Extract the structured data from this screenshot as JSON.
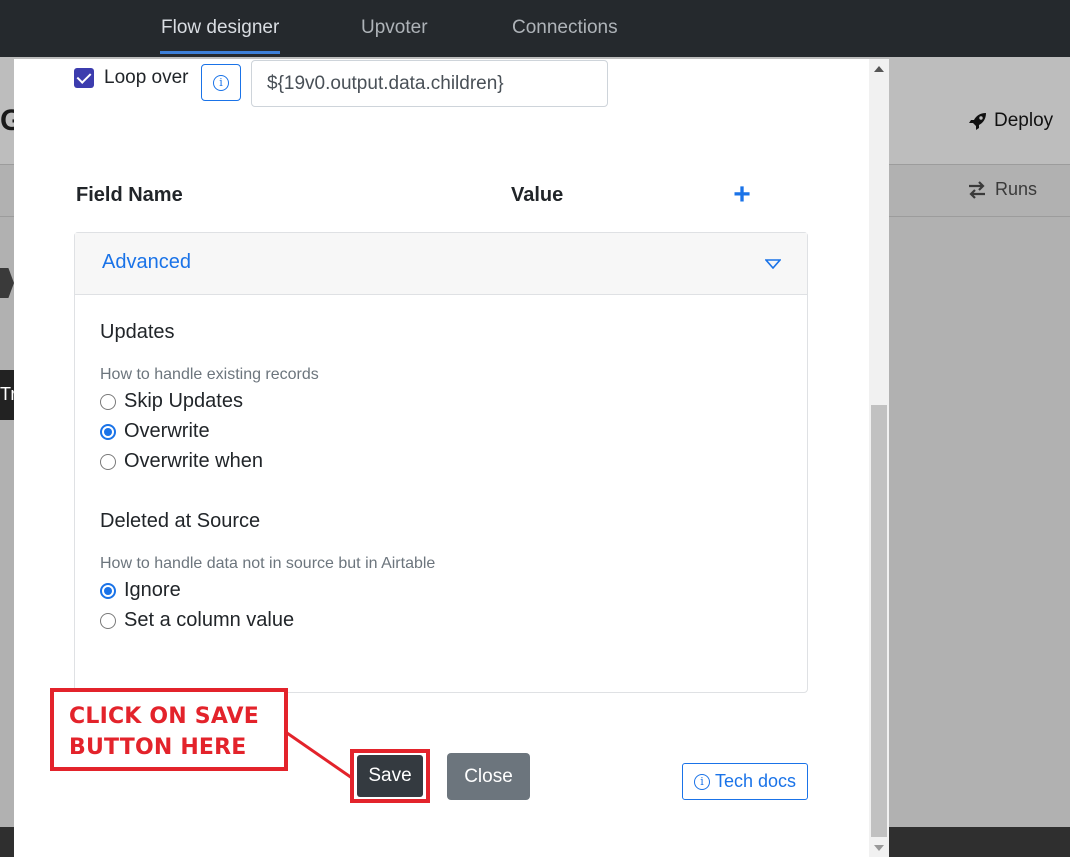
{
  "nav": {
    "tabs": [
      {
        "label": "Flow designer",
        "active": true
      },
      {
        "label": "Upvoter",
        "active": false
      },
      {
        "label": "Connections",
        "active": false
      }
    ]
  },
  "background": {
    "title_fragment": "G",
    "deploy_label": "Deploy",
    "runs_label": "Runs",
    "node_fragment": "Tri"
  },
  "modal": {
    "loop": {
      "checked": true,
      "label": "Loop over",
      "value": "${19v0.output.data.children}"
    },
    "columns": {
      "field_name": "Field Name",
      "value": "Value"
    },
    "advanced": {
      "title": "Advanced",
      "updates": {
        "title": "Updates",
        "hint": "How to handle existing records",
        "options": [
          {
            "label": "Skip Updates",
            "checked": false
          },
          {
            "label": "Overwrite",
            "checked": true
          },
          {
            "label": "Overwrite when",
            "checked": false
          }
        ]
      },
      "deleted": {
        "title": "Deleted at Source",
        "hint": "How to handle data not in source but in Airtable",
        "options": [
          {
            "label": "Ignore",
            "checked": true
          },
          {
            "label": "Set a column value",
            "checked": false
          }
        ]
      }
    },
    "buttons": {
      "save": "Save",
      "close": "Close",
      "tech_docs": "Tech docs"
    }
  },
  "annotation": {
    "line1": "CLICK ON SAVE",
    "line2": "BUTTON HERE",
    "color": "#e3232b"
  }
}
